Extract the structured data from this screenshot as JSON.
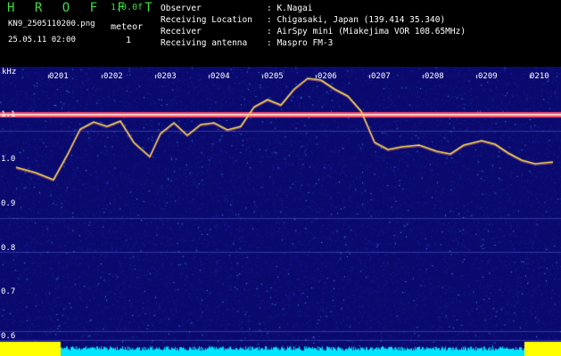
{
  "header": {
    "title": "H R O F F T",
    "version": "1.0.0f",
    "filename": "KN9_2505110200.png",
    "datetime": "25.05.11 02:00",
    "meteor_label": "meteor",
    "meteor_count": "1"
  },
  "observer_info": [
    {
      "key": "Observer",
      "value": ": K.Nagai"
    },
    {
      "key": "Receiving Location",
      "value": ": Chigasaki, Japan (139.414 35.340)"
    },
    {
      "key": "Receiver",
      "value": ": AirSpy mini (Miakejima VOR 108.65MHz)"
    },
    {
      "key": "Receiving antenna",
      "value": ": Maspro FM-3"
    }
  ],
  "spectrogram": {
    "unit": "kHz",
    "y_ticks": [
      "1.1",
      "1.0",
      "0.9",
      "0.8",
      "0.7",
      "0.6"
    ],
    "x_ticks": [
      "0201",
      "0202",
      "0203",
      "0204",
      "0205",
      "0206",
      "0207",
      "0208",
      "0209",
      "0210"
    ],
    "carrier_khz": 1.1,
    "background_color": "#0a0a6e",
    "trace_color": "#ffe34a",
    "band_color": "#ff4a6a",
    "floor_color": "#ffff00"
  }
}
